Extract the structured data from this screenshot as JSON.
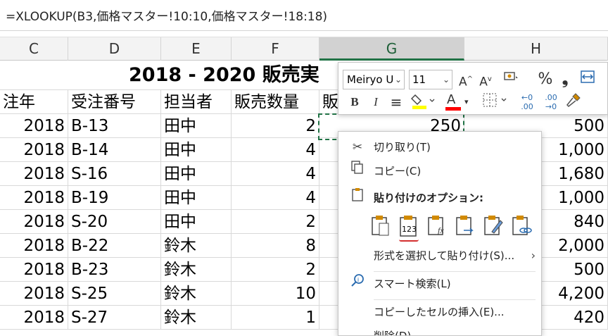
{
  "formula_bar": {
    "formula": "=XLOOKUP(B3,価格マスター!10:10,価格マスター!18:18)"
  },
  "column_headers": [
    "C",
    "D",
    "E",
    "F",
    "G",
    "H"
  ],
  "title": "2018 - 2020 販売実",
  "table_headers": [
    "注年",
    "受注番号",
    "担当者",
    "販売数量",
    "販"
  ],
  "rows": [
    {
      "year": "2018",
      "order": "B-13",
      "person": "田中",
      "qty": "2",
      "price": "250",
      "total": "500"
    },
    {
      "year": "2018",
      "order": "B-14",
      "person": "田中",
      "qty": "4",
      "price": "",
      "total": "1,000"
    },
    {
      "year": "2018",
      "order": "S-16",
      "person": "田中",
      "qty": "4",
      "price": "",
      "total": "1,680"
    },
    {
      "year": "2018",
      "order": "B-19",
      "person": "田中",
      "qty": "4",
      "price": "",
      "total": "1,000"
    },
    {
      "year": "2018",
      "order": "S-20",
      "person": "田中",
      "qty": "2",
      "price": "",
      "total": "840"
    },
    {
      "year": "2018",
      "order": "B-22",
      "person": "鈴木",
      "qty": "8",
      "price": "",
      "total": "2,000"
    },
    {
      "year": "2018",
      "order": "B-23",
      "person": "鈴木",
      "qty": "2",
      "price": "",
      "total": "500"
    },
    {
      "year": "2018",
      "order": "S-25",
      "person": "鈴木",
      "qty": "10",
      "price": "",
      "total": "4,200"
    },
    {
      "year": "2018",
      "order": "S-27",
      "person": "鈴木",
      "qty": "1",
      "price": "",
      "total": "420"
    }
  ],
  "mini_toolbar": {
    "font_name": "Meiryo U",
    "font_size": "11",
    "percent": "%",
    "comma": "❟",
    "bold": "B",
    "italic": "I",
    "font_color_letter": "A",
    "colors": {
      "highlight": "#ffff00",
      "font": "#ff0000",
      "accent": "#217346"
    }
  },
  "context_menu": {
    "cut": "切り取り(T)",
    "copy": "コピー(C)",
    "paste_options_header": "貼り付けのオプション:",
    "paste_icons": [
      "paste-icon",
      "paste-values-icon",
      "paste-formulas-icon",
      "paste-transpose-icon",
      "paste-formatting-icon",
      "paste-link-icon"
    ],
    "paste_values_label": "123",
    "paste_special": "形式を選択して貼り付け(S)...",
    "smart_lookup": "スマート検索(L)",
    "insert_copied_cells": "コピーしたセルの挿入(E)...",
    "delete": "削除(D)"
  }
}
